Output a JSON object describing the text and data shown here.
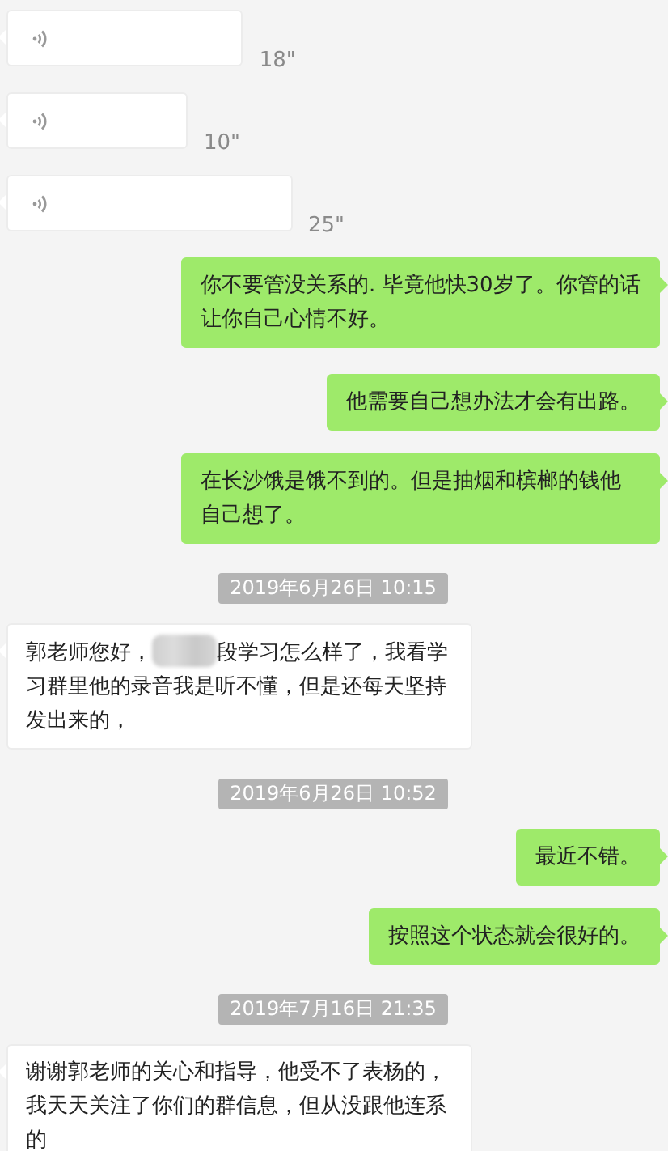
{
  "messages": [
    {
      "kind": "incoming_voice",
      "duration": "18\""
    },
    {
      "kind": "incoming_voice",
      "duration": "10\""
    },
    {
      "kind": "incoming_voice",
      "duration": "25\""
    },
    {
      "kind": "outgoing_text",
      "text": "你不要管没关系的. 毕竟他快30岁了。你管的话让你自己心情不好。"
    },
    {
      "kind": "outgoing_text",
      "text": "他需要自己想办法才会有出路。"
    },
    {
      "kind": "outgoing_text",
      "text": "在长沙饿是饿不到的。但是抽烟和槟榔的钱他自己想了。"
    },
    {
      "kind": "time",
      "text": "2019年6月26日 10:15"
    },
    {
      "kind": "incoming_redacted",
      "text_before": "郭老师您好，",
      "text_after": "段学习怎么样了，我看学习群里他的录音我是听不懂，但是还每天坚持发出来的，"
    },
    {
      "kind": "time",
      "text": "2019年6月26日 10:52"
    },
    {
      "kind": "outgoing_text",
      "text": "最近不错。"
    },
    {
      "kind": "outgoing_text",
      "text": "按照这个状态就会很好的。"
    },
    {
      "kind": "time",
      "text": "2019年7月16日 21:35"
    },
    {
      "kind": "incoming_text",
      "text": "谢谢郭老师的关心和指导，他受不了表杨的，我天天关注了你们的群信息，但从没跟他连系的"
    }
  ]
}
